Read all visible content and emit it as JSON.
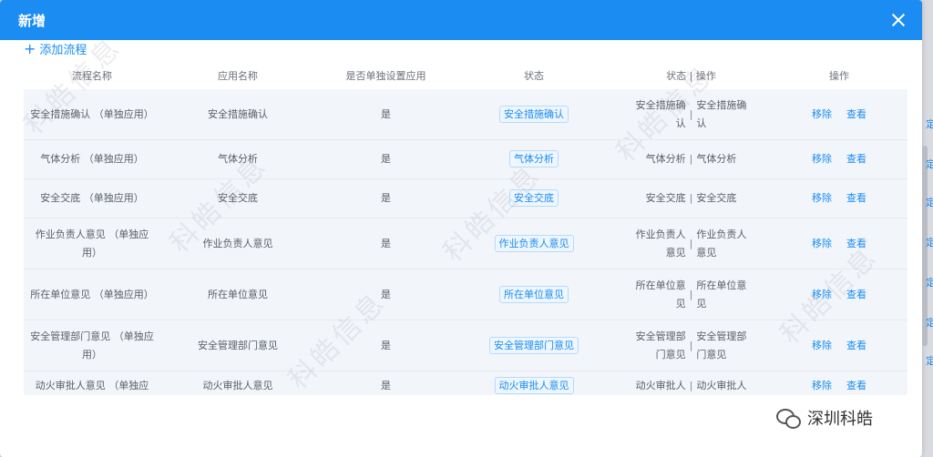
{
  "dialog": {
    "title": "新增",
    "add_label": "添加流程"
  },
  "table": {
    "headers": [
      "流程名称",
      "应用名称",
      "是否单独设置应用",
      "状态",
      "状态 | 操作",
      "操作"
    ],
    "rows": [
      {
        "name": "安全措施确认 （单独应用）",
        "app": "安全措施确认",
        "separate": "是",
        "tag": "安全措施确认",
        "status_left": "安全措施确认",
        "status_right": "安全措施确认",
        "edit": "移除",
        "view": "查看"
      },
      {
        "name": "气体分析 （单独应用）",
        "app": "气体分析",
        "separate": "是",
        "tag": "气体分析",
        "status_left": "气体分析",
        "status_right": "气体分析",
        "edit": "移除",
        "view": "查看"
      },
      {
        "name": "安全交底 （单独应用）",
        "app": "安全交底",
        "separate": "是",
        "tag": "安全交底",
        "status_left": "安全交底",
        "status_right": "安全交底",
        "edit": "移除",
        "view": "查看"
      },
      {
        "name": "作业负责人意见 （单独应用）",
        "app": "作业负责人意见",
        "separate": "是",
        "tag": "作业负责人意见",
        "status_left": "作业负责人意见",
        "status_right": "作业负责人意见",
        "edit": "移除",
        "view": "查看"
      },
      {
        "name": "所在单位意见 （单独应用）",
        "app": "所在单位意见",
        "separate": "是",
        "tag": "所在单位意见",
        "status_left": "所在单位意见",
        "status_right": "所在单位意见",
        "edit": "移除",
        "view": "查看"
      },
      {
        "name": "安全管理部门意见 （单独应用）",
        "app": "安全管理部门意见",
        "separate": "是",
        "tag": "安全管理部门意见",
        "status_left": "安全管理部门意见",
        "status_right": "安全管理部门意见",
        "edit": "移除",
        "view": "查看"
      },
      {
        "name": "动火审批人意见 （单独应",
        "app": "动火审批人意见",
        "separate": "是",
        "tag": "动火审批人意见",
        "status_left": "动火审批人",
        "status_right": "动火审批人",
        "edit": "移除",
        "view": "查看"
      }
    ]
  },
  "watermark_text": "科皓信息",
  "brand": {
    "label": "深圳科皓"
  },
  "side_marks": [
    "定",
    "定",
    "定",
    "定",
    "定",
    "定",
    "定"
  ]
}
